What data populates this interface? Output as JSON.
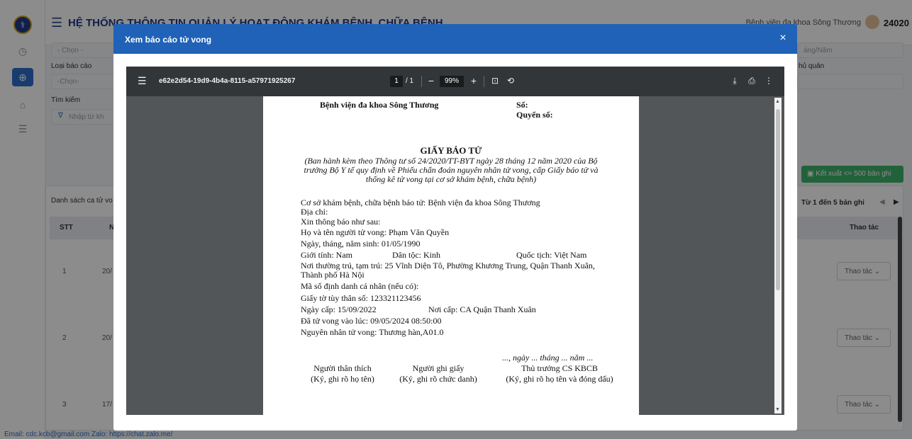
{
  "app": {
    "title": "HỆ THỐNG THÔNG TIN QUẢN LÝ HOẠT ĐỘNG KHÁM BỆNH, CHỮA BỆNH",
    "hospital": "Bệnh viện đa khoa Sông Thương",
    "user_id": "24020"
  },
  "filters": {
    "select_placeholder": "- Chọn -",
    "report_type_label": "Loại báo cáo",
    "report_type_placeholder": "-Chọn-",
    "search_label": "Tìm kiếm",
    "search_placeholder": "Nhập từ kh",
    "date_placeholder": "áng/Năm",
    "owner_label": "hủ quản"
  },
  "export_button": "Kết xuất <= 500 bản ghi",
  "list": {
    "title": "Danh sách ca tử vo",
    "paging": "Từ 1 đến 5 bản ghi",
    "columns": {
      "stt": "STT",
      "n": "N",
      "actions": "Thao tác"
    },
    "rows": [
      {
        "stt": "1",
        "date": "20/",
        "action": "Thao tác"
      },
      {
        "stt": "2",
        "date": "20/",
        "action": "Thao tác"
      },
      {
        "stt": "3",
        "date": "17/",
        "action": "Thao tác"
      }
    ]
  },
  "footer": "Email: cdc.kcb@gmail.com  Zalo: https://chat.zalo.me/",
  "modal": {
    "title": "Xem báo cáo tử vong",
    "close": "×"
  },
  "pdf": {
    "filename": "e62e2d54-19d9-4b4a-8115-a57971925267",
    "page": "1",
    "page_total": "/ 1",
    "zoom": "99%"
  },
  "certificate": {
    "hospital": "Bệnh viện đa khoa Sông Thương",
    "so": "Số:",
    "quyen_so": "Quyển số:",
    "heading": "GIẤY BÁO TỬ",
    "subtitle_1": "(Ban hành kèm theo Thông tư số 24/2020/TT-BYT ngày 28 tháng 12 năm 2020 của Bộ",
    "subtitle_2": "trưởng Bộ Y tế quy định về Phiếu chẩn đoán nguyên nhân tử vong, cấp Giấy báo tử và",
    "subtitle_3": "thống kê tử vong tại cơ sở khám bệnh, chữa bệnh)",
    "facility": "Cơ sở khám bệnh, chữa bệnh báo tử: Bệnh viện đa khoa Sông Thương",
    "address": "Địa chỉ:",
    "notice": "Xin thông báo như sau:",
    "name": "Họ và tên người tử vong: Phạm Văn Quyền",
    "dob": "Ngày, tháng, năm sinh: 01/05/1990",
    "gender": "Giới tính: Nam",
    "ethnicity": "Dân tộc: Kinh",
    "nationality": "Quốc tịch: Việt Nam",
    "residence_1": "Nơi thường trú, tạm trú: 25 Vĩnh Diện Tô, Phường Khương Trung, Quận Thanh Xuân,",
    "residence_2": "Thành phố Hà Nội",
    "personal_id": "Mã số định danh cá nhân (nếu có):",
    "id_doc": "Giấy tờ tùy thân số: 123321123456",
    "issue_date": "Ngày cấp: 15/09/2022",
    "issue_place": "Nơi cấp: CA Quận Thanh Xuân",
    "death_time": "Đã tử vong vào lúc: 09/05/2024 08:50:00",
    "cause": "Nguyên nhân tử vong: Thương hàn,A01.0",
    "date_line": "..., ngày ... tháng ... năm ...",
    "sig1_title": "Người thân thích",
    "sig1_note": "(Ký, ghi rõ họ tên)",
    "sig2_title": "Người ghi giấy",
    "sig2_note": "(Ký, ghi rõ chức danh)",
    "sig3_title": "Thủ trưởng CS KBCB",
    "sig3_note": "(Ký, ghi rõ họ tên và đóng dấu)"
  }
}
